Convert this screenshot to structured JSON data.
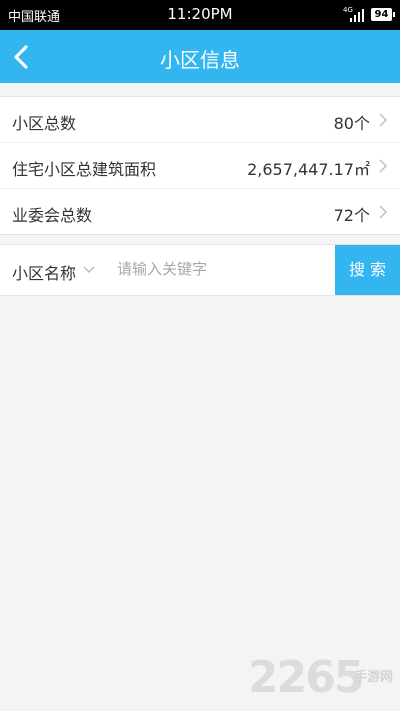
{
  "status_bar": {
    "carrier": "中国联通",
    "time": "11:20PM",
    "network": "4G",
    "battery": "94"
  },
  "header": {
    "title": "小区信息",
    "back_icon": "chevron-left-icon"
  },
  "stats": [
    {
      "label": "小区总数",
      "value": "80个"
    },
    {
      "label": "住宅小区总建筑面积",
      "value": "2,657,447.17㎡"
    },
    {
      "label": "业委会总数",
      "value": "72个"
    }
  ],
  "search": {
    "field": "小区名称",
    "placeholder": "请输入关键字",
    "button": "搜 索"
  },
  "watermark": {
    "logo": "2265",
    "text": "手游网"
  },
  "colors": {
    "accent": "#33b5f0",
    "background": "#f4f4f4"
  }
}
